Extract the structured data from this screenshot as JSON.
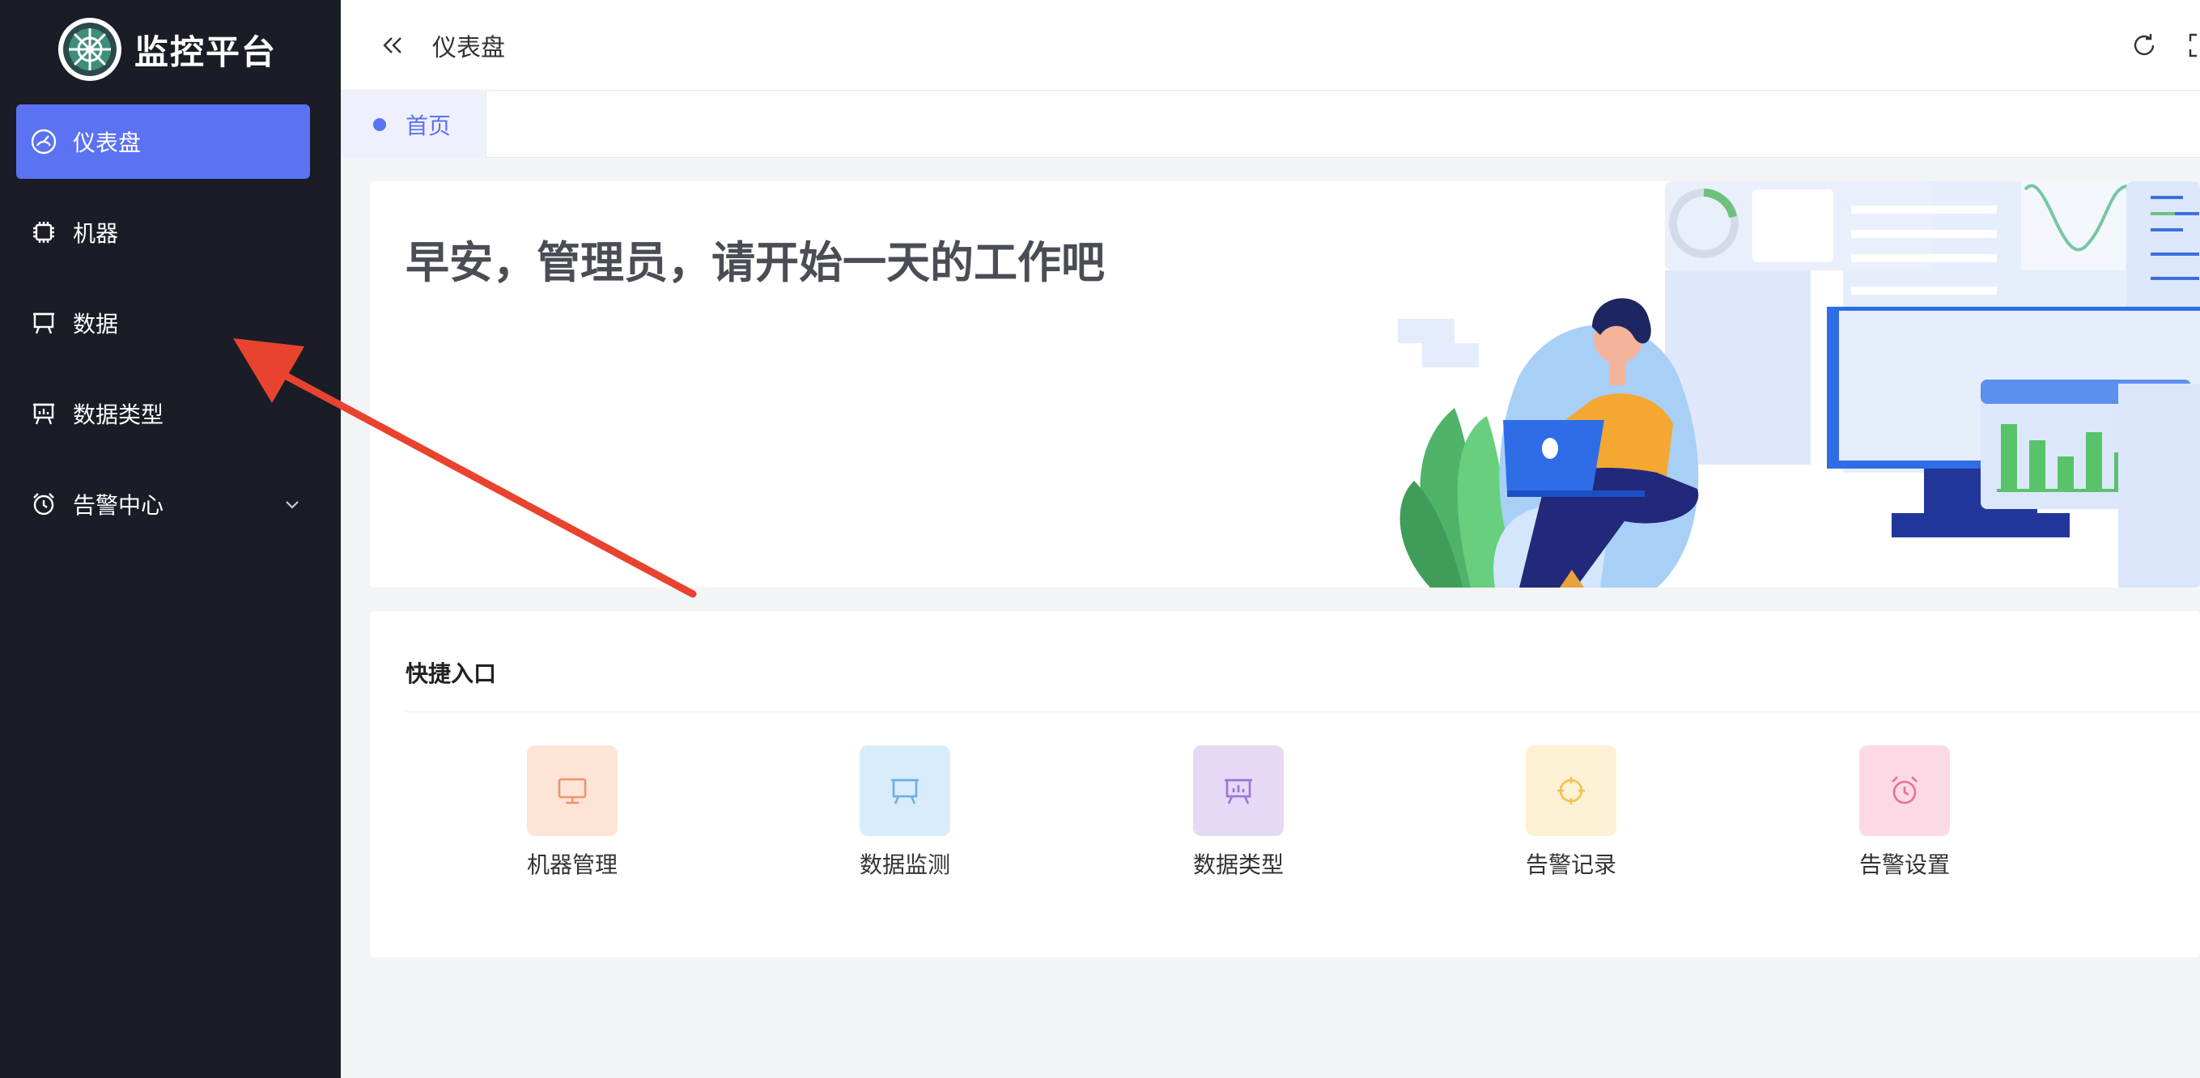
{
  "sidebar": {
    "brand": {
      "title": "监控平台",
      "logo_icon": "radar-logo-icon"
    },
    "items": [
      {
        "label": "仪表盘",
        "icon": "dashboard-gauge-icon",
        "active": true
      },
      {
        "label": "机器",
        "icon": "chip-icon",
        "active": false
      },
      {
        "label": "数据",
        "icon": "presentation-board-icon",
        "active": false
      },
      {
        "label": "数据类型",
        "icon": "chart-board-icon",
        "active": false
      },
      {
        "label": "告警中心",
        "icon": "alarm-clock-icon",
        "active": false,
        "expandable": true
      }
    ]
  },
  "header": {
    "title": "仪表盘",
    "collapse_icon": "double-chevron-left-icon",
    "refresh_icon": "refresh-icon",
    "fullscreen_icon": "fullscreen-icon"
  },
  "tabs": [
    {
      "label": "首页",
      "active": true
    }
  ],
  "welcome": {
    "greeting": "早安，管理员，请开始一天的工作吧"
  },
  "quick_entry": {
    "title": "快捷入口",
    "items": [
      {
        "label": "机器管理",
        "icon": "monitor-icon",
        "bg": "#fde4d6",
        "color": "#f0936a"
      },
      {
        "label": "数据监测",
        "icon": "presentation-board-icon",
        "bg": "#d9ecfb",
        "color": "#6aaee8"
      },
      {
        "label": "数据类型",
        "icon": "chart-board-icon",
        "bg": "#e5d9f6",
        "color": "#9a74d4"
      },
      {
        "label": "告警记录",
        "icon": "target-icon",
        "bg": "#fdf1d4",
        "color": "#f1c24e"
      },
      {
        "label": "告警设置",
        "icon": "alarm-clock-icon",
        "bg": "#fbdae6",
        "color": "#ea6e98"
      }
    ]
  },
  "colors": {
    "sidebar_bg": "#1a1c26",
    "accent": "#5b72f2",
    "annotation_arrow": "#e8432f"
  }
}
